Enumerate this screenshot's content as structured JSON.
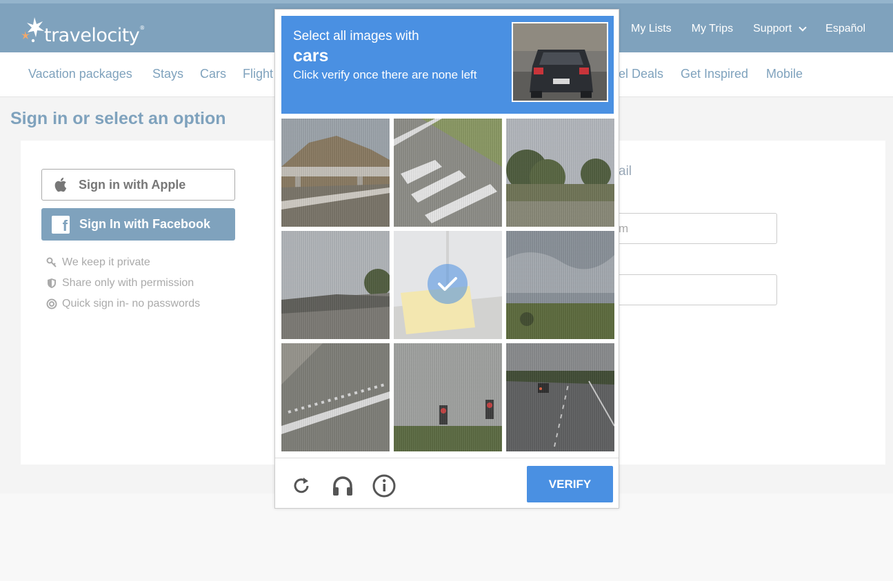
{
  "header": {
    "logo_text": "travelocity",
    "top_links": [
      "My Lists",
      "My Trips",
      "Support",
      "Español"
    ]
  },
  "subnav": {
    "items": [
      "Vacation packages",
      "Stays",
      "Cars",
      "Flight",
      "el Deals",
      "Get Inspired",
      "Mobile"
    ]
  },
  "page": {
    "title": "Sign in or select an option",
    "apple_label": "Sign in with Apple",
    "facebook_label": "Sign In with Facebook",
    "perks": [
      "We keep it private",
      "Share only with permission",
      "Quick sign in- no passwords"
    ],
    "right_hint": "ail",
    "email_field_text": "m"
  },
  "captcha": {
    "line1": "Select all images with",
    "target": "cars",
    "line3": "Click verify once there are none left",
    "verify_label": "VERIFY",
    "selected_tiles": [
      5
    ],
    "icons": [
      "reload-icon",
      "audio-icon",
      "info-icon"
    ]
  },
  "colors": {
    "brand": "#7fa2bd",
    "captcha_blue": "#4a90e2"
  }
}
